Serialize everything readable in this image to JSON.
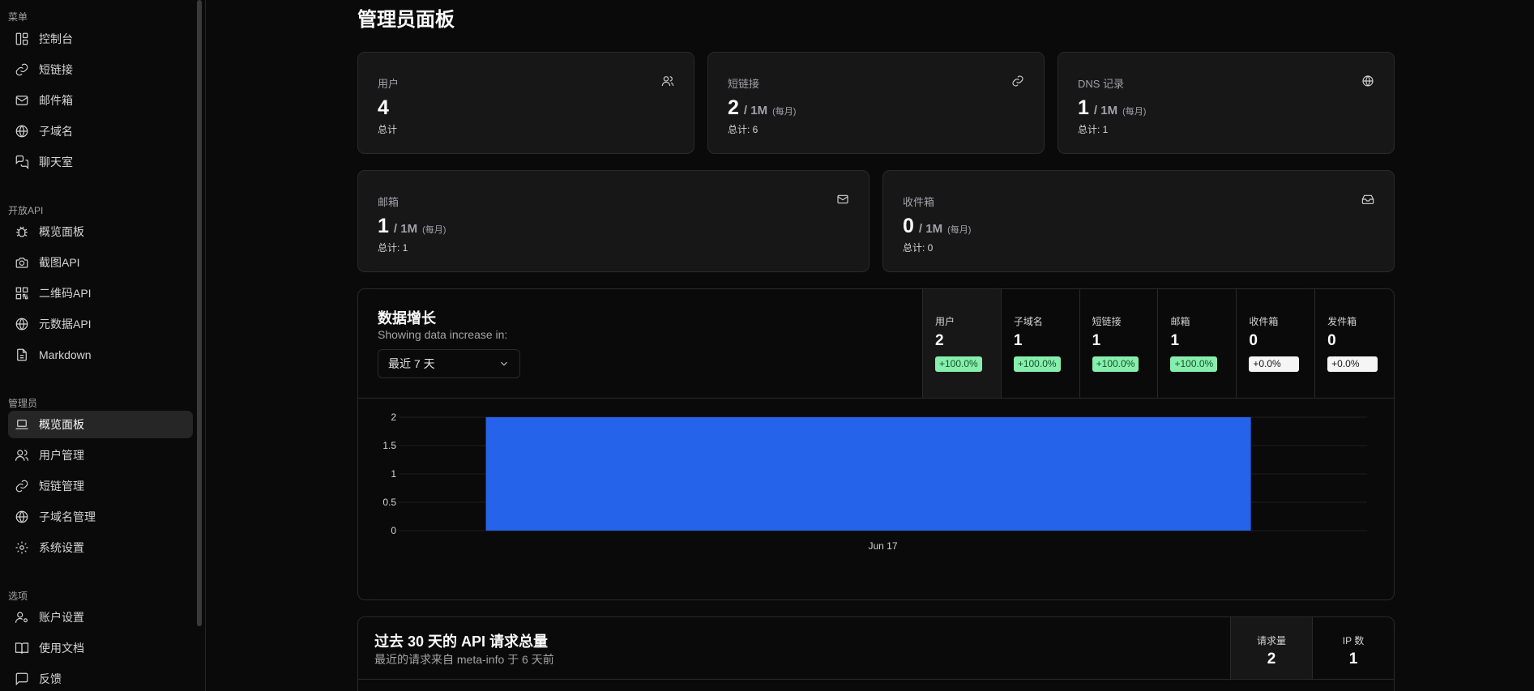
{
  "sidebar": {
    "sections": [
      {
        "title": "菜单",
        "items": [
          {
            "label": "控制台",
            "icon": "dashboard-icon"
          },
          {
            "label": "短链接",
            "icon": "link-icon"
          },
          {
            "label": "邮件箱",
            "icon": "mail-icon"
          },
          {
            "label": "子域名",
            "icon": "globe-icon"
          },
          {
            "label": "聊天室",
            "icon": "chat-icon"
          }
        ]
      },
      {
        "title": "开放API",
        "items": [
          {
            "label": "概览面板",
            "icon": "bug-icon"
          },
          {
            "label": "截图API",
            "icon": "camera-icon"
          },
          {
            "label": "二维码API",
            "icon": "qrcode-icon"
          },
          {
            "label": "元数据API",
            "icon": "globe-icon"
          },
          {
            "label": "Markdown",
            "icon": "file-icon"
          }
        ]
      },
      {
        "title": "管理员",
        "items": [
          {
            "label": "概览面板",
            "icon": "laptop-icon",
            "active": true
          },
          {
            "label": "用户管理",
            "icon": "users-icon"
          },
          {
            "label": "短链管理",
            "icon": "link-icon"
          },
          {
            "label": "子域名管理",
            "icon": "globe-icon"
          },
          {
            "label": "系统设置",
            "icon": "gear-icon"
          }
        ]
      },
      {
        "title": "选项",
        "items": [
          {
            "label": "账户设置",
            "icon": "user-settings-icon"
          },
          {
            "label": "使用文档",
            "icon": "book-icon"
          },
          {
            "label": "反馈",
            "icon": "feedback-icon"
          }
        ]
      }
    ]
  },
  "page": {
    "title": "管理员面板"
  },
  "cards_row1": [
    {
      "label": "用户",
      "value": "4",
      "limit": "",
      "period": "",
      "sub": "总计",
      "icon": "users-icon"
    },
    {
      "label": "短链接",
      "value": "2",
      "limit": "/ 1M",
      "period": "(每月)",
      "sub": "总计: 6",
      "icon": "link-icon"
    },
    {
      "label": "DNS 记录",
      "value": "1",
      "limit": "/ 1M",
      "period": "(每月)",
      "sub": "总计: 1",
      "icon": "globe-icon"
    }
  ],
  "cards_row2": [
    {
      "label": "邮箱",
      "value": "1",
      "limit": "/ 1M",
      "period": "(每月)",
      "sub": "总计: 1",
      "icon": "mail-icon"
    },
    {
      "label": "收件箱",
      "value": "0",
      "limit": "/ 1M",
      "period": "(每月)",
      "sub": "总计: 0",
      "icon": "inbox-icon"
    }
  ],
  "growth": {
    "title": "数据增长",
    "description": "Showing data increase in:",
    "range_selected": "最近 7 天",
    "stats": [
      {
        "label": "用户",
        "value": "2",
        "change": "+100.0%",
        "positive": true,
        "active": true
      },
      {
        "label": "子域名",
        "value": "1",
        "change": "+100.0%",
        "positive": true
      },
      {
        "label": "短链接",
        "value": "1",
        "change": "+100.0%",
        "positive": true
      },
      {
        "label": "邮箱",
        "value": "1",
        "change": "+100.0%",
        "positive": true
      },
      {
        "label": "收件箱",
        "value": "0",
        "change": "+0.0%",
        "positive": false
      },
      {
        "label": "发件箱",
        "value": "0",
        "change": "+0.0%",
        "positive": false
      }
    ]
  },
  "chart_data": {
    "type": "bar",
    "categories": [
      "Jun 17"
    ],
    "series": [
      {
        "values": [
          2
        ]
      }
    ],
    "yticks": [
      "0",
      "0.5",
      "1",
      "1.5",
      "2"
    ],
    "ylim": [
      0,
      2
    ],
    "bar_color": "#2563eb",
    "grid": true
  },
  "api": {
    "title": "过去 30 天的 API 请求总量",
    "description": "最近的请求来自 meta-info 于 6 天前",
    "stats": [
      {
        "label": "请求量",
        "value": "2"
      },
      {
        "label": "IP 数",
        "value": "1"
      }
    ]
  }
}
